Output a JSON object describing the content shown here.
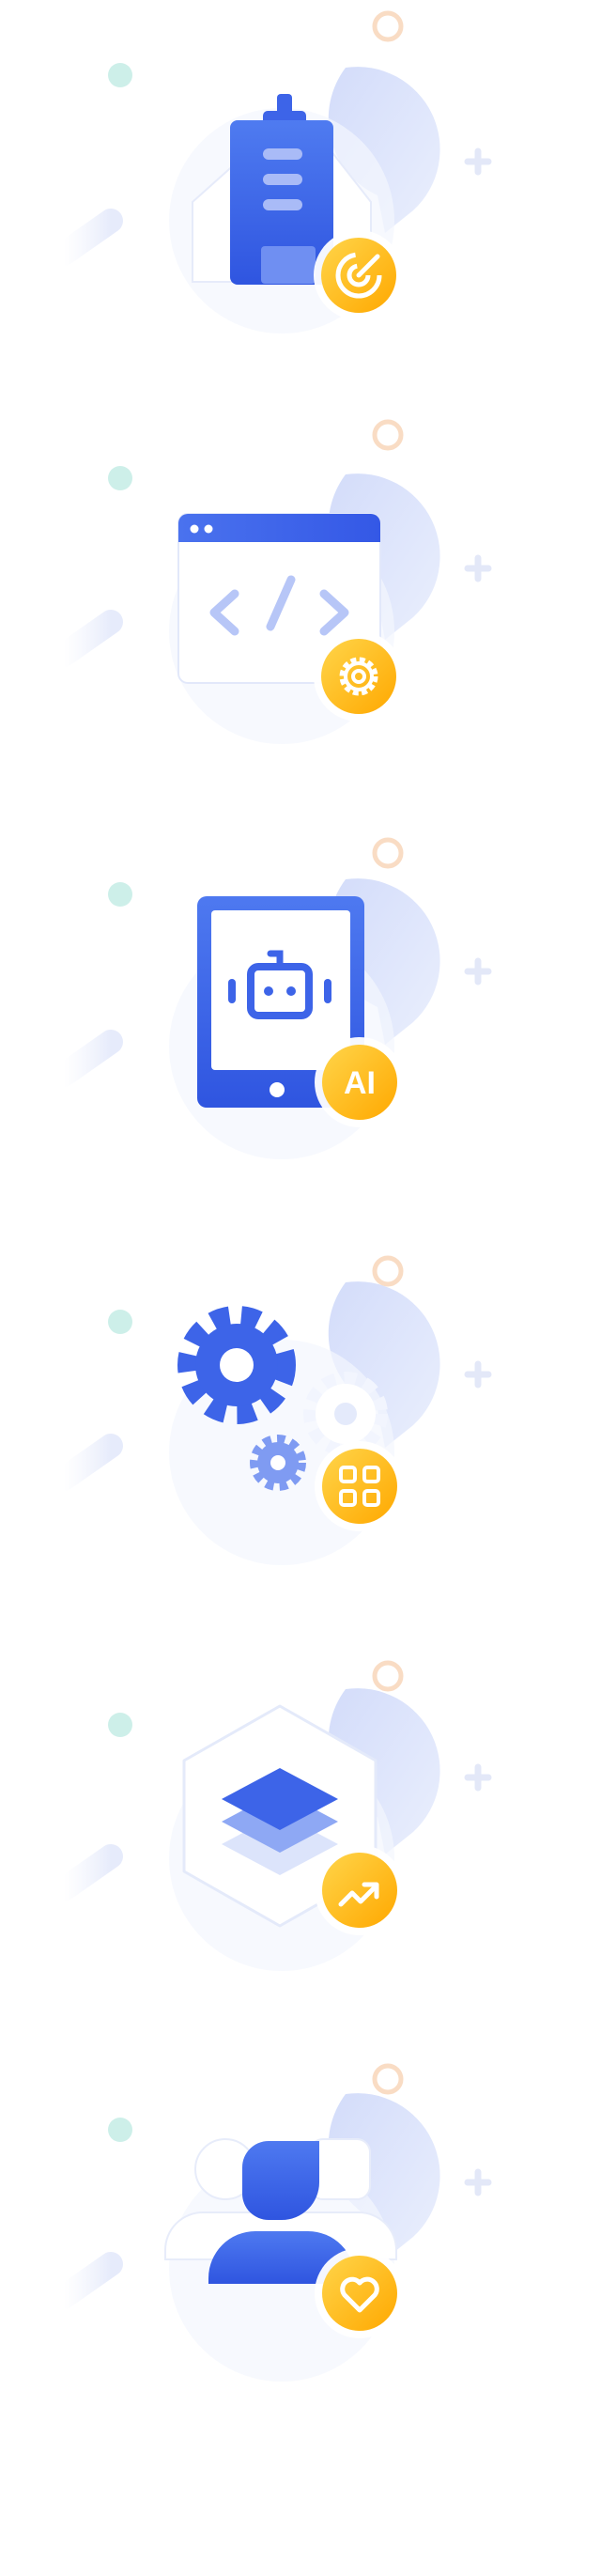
{
  "colors": {
    "primary_blue": "#3D64E8",
    "light_blue": "#A9BBF7",
    "pale_blue": "#DDE4FB",
    "badge_orange": "#FFB300",
    "badge_yellow": "#FFD54A",
    "teal_dot": "#CDEFE9",
    "peach_ring": "#F9DCC4",
    "plus_color": "#E3E8F8",
    "background": "#FFFFFF"
  },
  "icons": [
    {
      "name": "building-radar-icon",
      "badge": "radar-icon"
    },
    {
      "name": "code-window-icon",
      "badge": "settings-gear-icon"
    },
    {
      "name": "tablet-robot-icon",
      "badge": "ai-text-icon",
      "badge_text": "AI"
    },
    {
      "name": "gears-icon",
      "badge": "grid-apps-icon"
    },
    {
      "name": "layers-hexagon-icon",
      "badge": "trend-up-icon"
    },
    {
      "name": "user-group-icon",
      "badge": "heart-icon"
    }
  ]
}
